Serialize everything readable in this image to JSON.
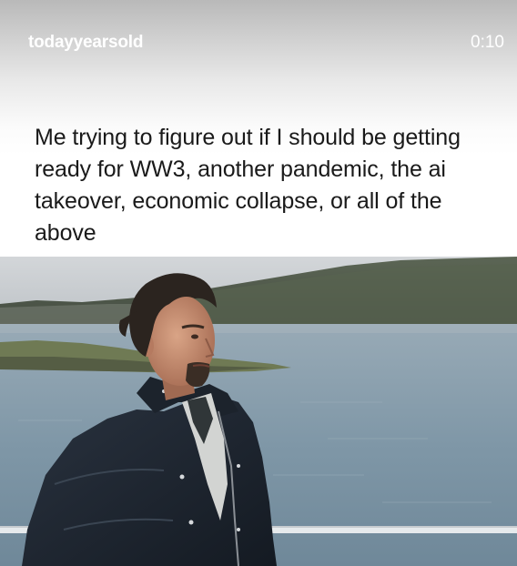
{
  "story": {
    "username": "todayyearsold",
    "time": "0:10"
  },
  "meme": {
    "caption": "Me trying to figure out if I should be getting ready for WW3, another pandemic, the ai takeover, economic collapse, or all of the above"
  },
  "video": {
    "scene": "man-on-boat-by-lake",
    "colors": {
      "sky": "#c8ccd0",
      "hills": "#4f5a4c",
      "water": "#8fa4b2",
      "jacket": "#1d2530"
    }
  }
}
